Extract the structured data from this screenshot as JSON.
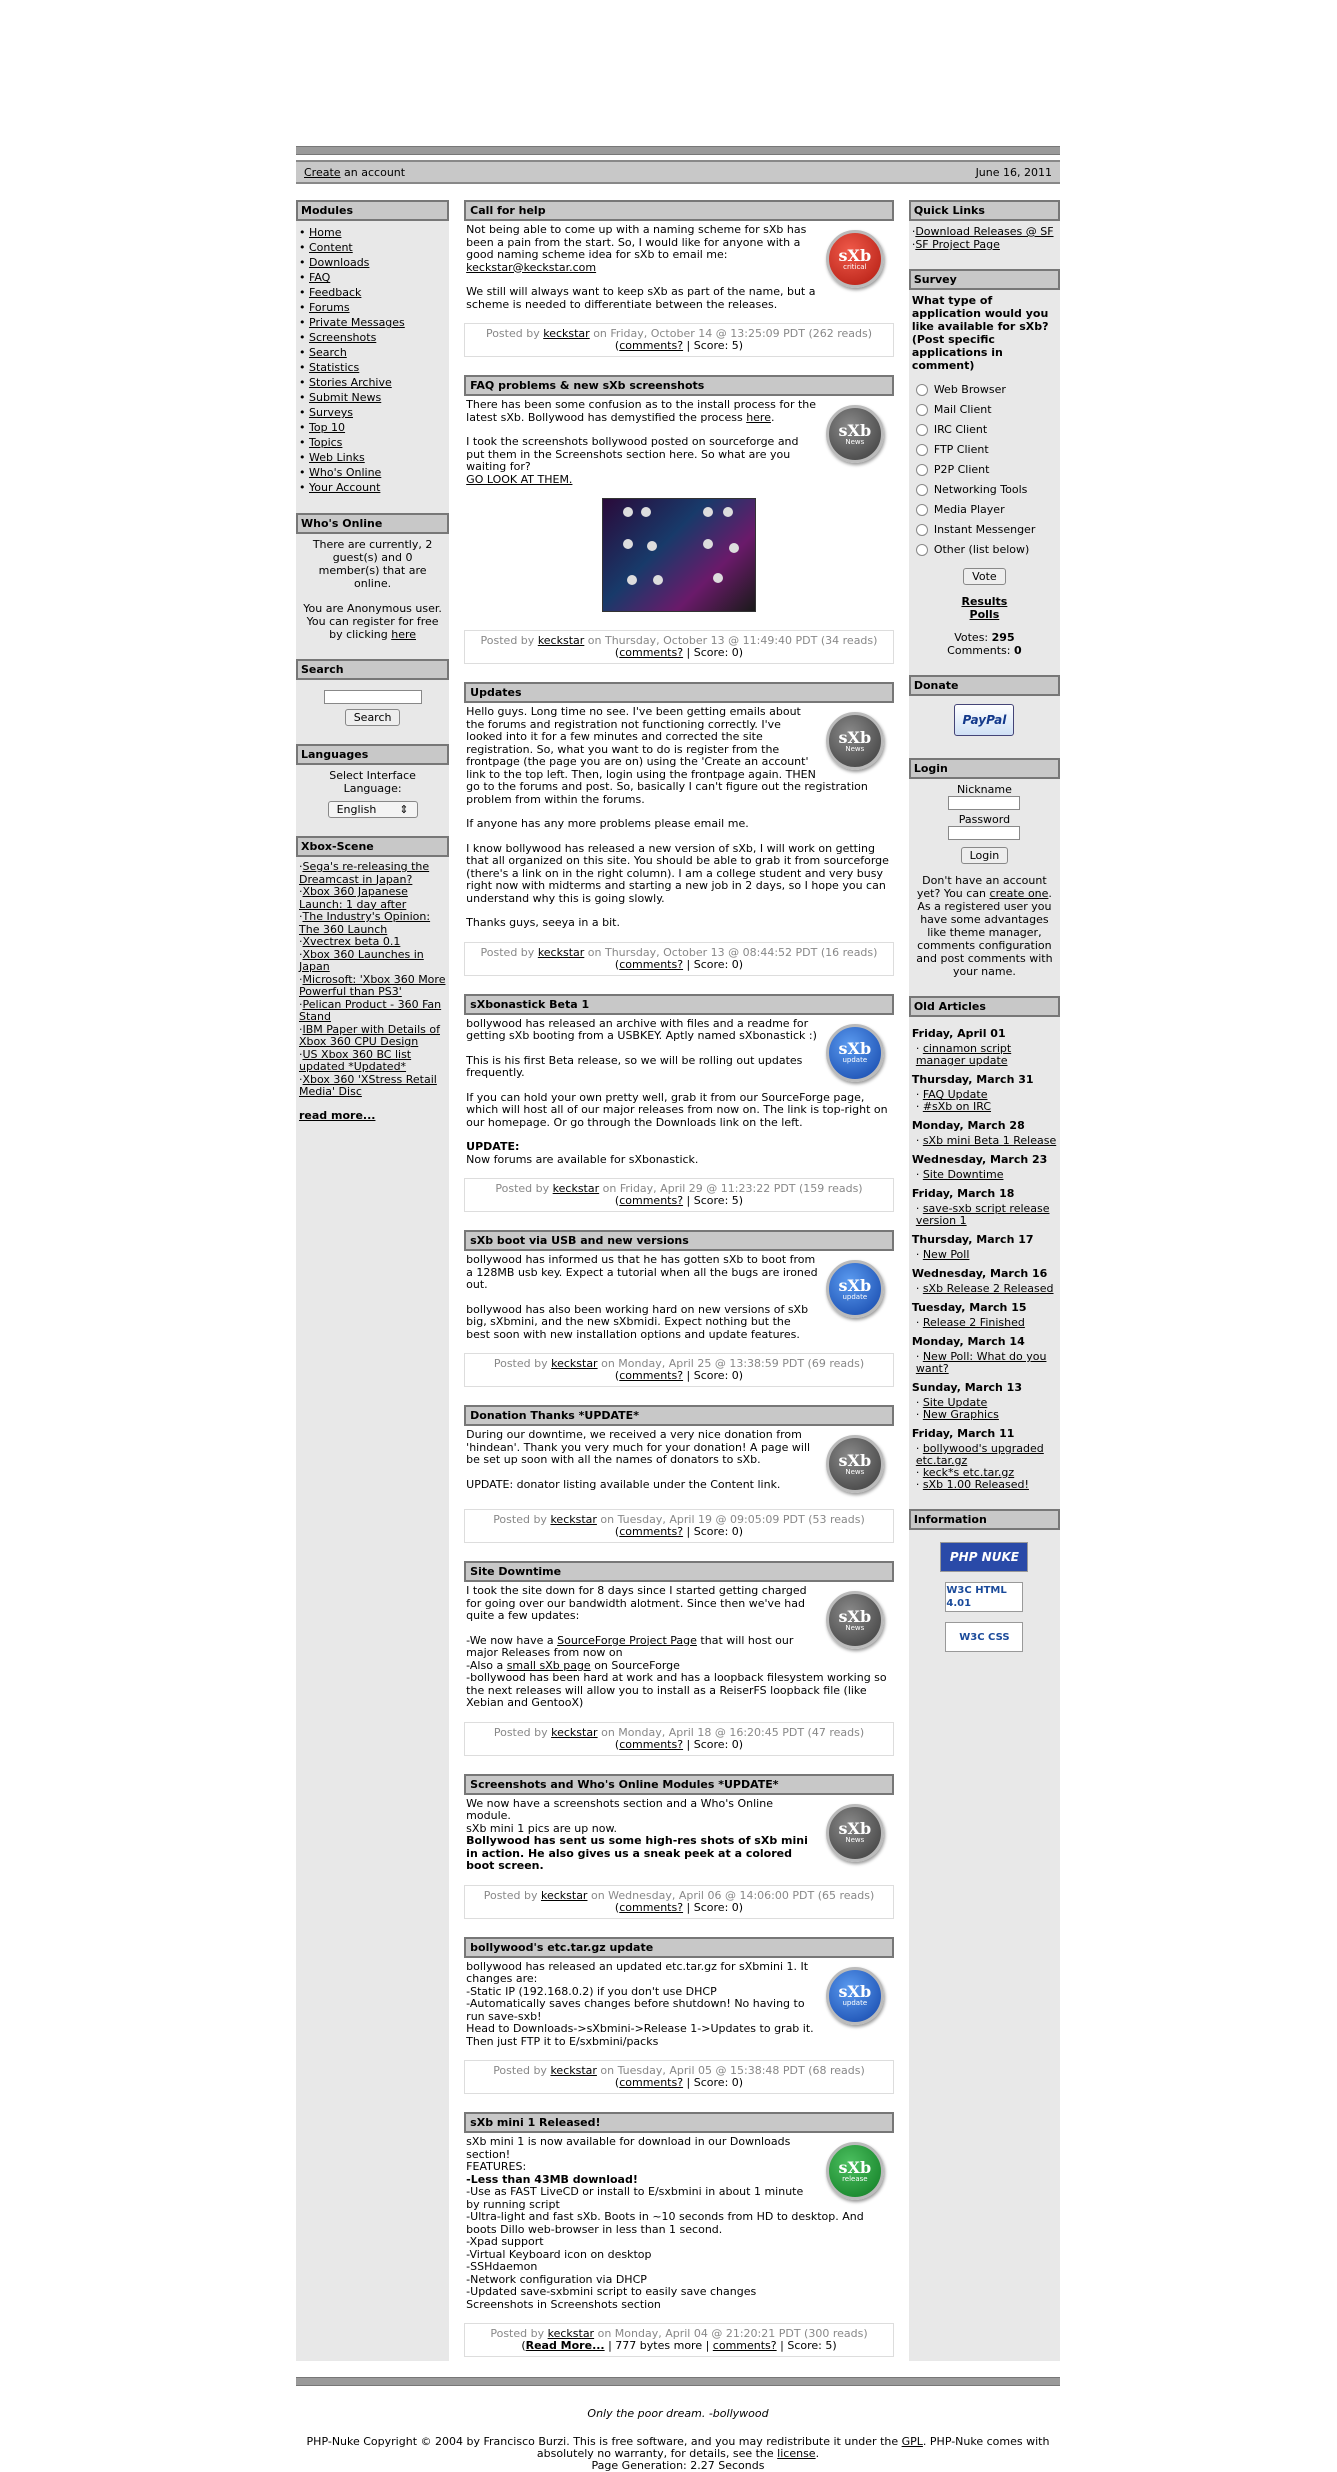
{
  "header": {
    "create_link": "Create",
    "create_rest": " an account",
    "date": "June 16, 2011"
  },
  "left": {
    "modules_title": "Modules",
    "modules": [
      "Home",
      "Content",
      "Downloads",
      "FAQ",
      "Feedback",
      "Forums",
      "Private Messages",
      "Screenshots",
      "Search",
      "Statistics",
      "Stories Archive",
      "Submit News",
      "Surveys",
      "Top 10",
      "Topics",
      "Web Links",
      "Who's Online",
      "Your Account"
    ],
    "whos_online_title": "Who's Online",
    "whos_online_text": "There are currently, 2 guest(s) and 0 member(s) that are online.",
    "anon_text": "You are Anonymous user. You can register for free by clicking",
    "anon_link": "here",
    "search_title": "Search",
    "search_button": "Search",
    "languages_title": "Languages",
    "languages_label": "Select Interface Language:",
    "languages_value": "English",
    "xbox_title": "Xbox-Scene",
    "xbox_items": [
      "Sega's re-releasing the Dreamcast in Japan?",
      "Xbox 360 Japanese Launch: 1 day after",
      "The Industry's Opinion: The 360 Launch",
      "Xvectrex beta 0.1",
      "Xbox 360 Launches in Japan",
      "Microsoft: 'Xbox 360 More Powerful than PS3'",
      "Pelican Product - 360 Fan Stand",
      "IBM Paper with Details of Xbox 360 CPU Design",
      "US Xbox 360 BC list updated *Updated*",
      "Xbox 360 'XStress Retail Media' Disc"
    ],
    "read_more": "read more..."
  },
  "stories": [
    {
      "title": "Call for help",
      "topic": "sXb",
      "topic_sub": "critical",
      "topic_class": "t-critical",
      "paras": [
        "Not being able to come up with a naming scheme for sXb has been a pain from the start. So, I would like for anyone with a good naming scheme idea for sXb to email me:",
        "We still will always want to keep sXb as part of the name, but a scheme is needed to differentiate between the releases."
      ],
      "email": "keckstar@keckstar.com",
      "posted": "Posted by",
      "author": "keckstar",
      "date": " on Friday, October 14 @ 13:25:09 PDT (262 reads)",
      "comments": "comments?",
      "score": " | Score: 5)"
    },
    {
      "title": "FAQ problems & new sXb screenshots",
      "topic": "sXb",
      "topic_sub": "News",
      "topic_class": "t-news",
      "p1": "There has been some confusion as to the install process for the latest sXb. Bollywood has demystified the process ",
      "p1_link": "here",
      "p2": "I took the screenshots bollywood posted on sourceforge and put them in the Screenshots section here. So what are you waiting for?",
      "p2_link": "GO LOOK AT THEM.",
      "posted": "Posted by",
      "author": "keckstar",
      "date": " on Thursday, October 13 @ 11:49:40 PDT (34 reads)",
      "comments": "comments?",
      "score": " | Score: 0)"
    },
    {
      "title": "Updates",
      "topic": "sXb",
      "topic_sub": "News",
      "topic_class": "t-news",
      "paras": [
        "Hello guys. Long time no see. I've been getting emails about the forums and registration not functioning correctly. I've looked into it for a few minutes and corrected the site registration. So, what you want to do is register from the frontpage (the page you are on) using the 'Create an account' link to the top left. Then, login using the frontpage again. THEN go to the forums and post. So, basically I can't figure out the registration problem from within the forums.",
        "If anyone has any more problems please email me.",
        "I know bollywood has released a new version of sXb, I will work on getting that all organized on this site. You should be able to grab it from sourceforge (there's a link on in the right column). I am a college student and very busy right now with midterms and starting a new job in 2 days, so I hope you can understand why this is going slowly.",
        "Thanks guys, seeya in a bit."
      ],
      "posted": "Posted by",
      "author": "keckstar",
      "date": " on Thursday, October 13 @ 08:44:52 PDT (16 reads)",
      "comments": "comments?",
      "score": " | Score: 0)"
    },
    {
      "title": "sXbonastick Beta 1",
      "topic": "sXb",
      "topic_sub": "update",
      "topic_class": "t-update",
      "paras": [
        "bollywood has released an archive with files and a readme for getting sXb booting from a USBKEY. Aptly named sXbonastick :)",
        "This is his first Beta release, so we will be rolling out updates frequently.",
        "If you can hold your own pretty well, grab it from our SourceForge page, which will host all of our major releases from now on. The link is top-right on our homepage. Or go through the Downloads link on the left."
      ],
      "update_label": "UPDATE:",
      "update_text": "Now forums are available for sXbonastick.",
      "posted": "Posted by",
      "author": "keckstar",
      "date": " on Friday, April 29 @ 11:23:22 PDT (159 reads)",
      "comments": "comments?",
      "score": " | Score: 5)"
    },
    {
      "title": "sXb boot via USB and new versions",
      "topic": "sXb",
      "topic_sub": "update",
      "topic_class": "t-update",
      "paras": [
        "bollywood has informed us that he has gotten sXb to boot from a 128MB usb key. Expect a tutorial when all the bugs are ironed out.",
        "bollywood has also been working hard on new versions of sXb big, sXbmini, and the new sXbmidi. Expect nothing but the best soon with new installation options and update features."
      ],
      "posted": "Posted by",
      "author": "keckstar",
      "date": " on Monday, April 25 @ 13:38:59 PDT (69 reads)",
      "comments": "comments?",
      "score": " | Score: 0)"
    },
    {
      "title": "Donation Thanks *UPDATE*",
      "topic": "sXb",
      "topic_sub": "News",
      "topic_class": "t-news",
      "paras": [
        "During our downtime, we received a very nice donation from 'hindean'. Thank you very much for your donation! A page will be set up soon with all the names of donators to sXb.",
        "UPDATE: donator listing available under the Content link."
      ],
      "posted": "Posted by",
      "author": "keckstar",
      "date": " on Tuesday, April 19 @ 09:05:09 PDT (53 reads)",
      "comments": "comments?",
      "score": " | Score: 0)"
    },
    {
      "title": "Site Downtime",
      "topic": "sXb",
      "topic_sub": "News",
      "topic_class": "t-news",
      "p1": "I took the site down for 8 days since I started getting charged for going over our bandwidth alotment. Since then we've had quite a few updates:",
      "l1a": "-We now have a ",
      "l1_link": "SourceForge Project Page",
      "l1b": " that will host our major Releases from now on",
      "l2a": "-Also a ",
      "l2_link": "small sXb page",
      "l2b": " on SourceForge",
      "l3": "-bollywood has been hard at work and has a loopback filesystem working so the next releases will allow you to install as a ReiserFS loopback file (like Xebian and GentooX)",
      "posted": "Posted by",
      "author": "keckstar",
      "date": " on Monday, April 18 @ 16:20:45 PDT (47 reads)",
      "comments": "comments?",
      "score": " | Score: 0)"
    },
    {
      "title": "Screenshots and Who's Online Modules *UPDATE*",
      "topic": "sXb",
      "topic_sub": "News",
      "topic_class": "t-news",
      "p1": "We now have a screenshots section and a Who's Online module.",
      "p2": "sXb mini 1 pics are up now.",
      "p3": "Bollywood has sent us some high-res shots of sXb mini in action. He also gives us a sneak peek at a colored boot screen.",
      "posted": "Posted by",
      "author": "keckstar",
      "date": " on Wednesday, April 06 @ 14:06:00 PDT (65 reads)",
      "comments": "comments?",
      "score": " | Score: 0)"
    },
    {
      "title": "bollywood's etc.tar.gz update",
      "topic": "sXb",
      "topic_sub": "update",
      "topic_class": "t-update",
      "lines": [
        "bollywood has released an updated etc.tar.gz for sXbmini 1. It changes are:",
        "-Static IP (192.168.0.2) if you don't use DHCP",
        "-Automatically saves changes before shutdown! No having to run save-sxb!",
        "Head to Downloads->sXbmini->Release 1->Updates to grab it. Then just FTP it to E/sxbmini/packs"
      ],
      "posted": "Posted by",
      "author": "keckstar",
      "date": " on Tuesday, April 05 @ 15:38:48 PDT (68 reads)",
      "comments": "comments?",
      "score": " | Score: 0)"
    },
    {
      "title": "sXb mini 1 Released!",
      "topic": "sXb",
      "topic_sub": "release",
      "topic_class": "t-release",
      "l1": "sXb mini 1 is now available for download in our Downloads section!",
      "l2": "FEATURES:",
      "l3": "-Less than 43MB download!",
      "lines": [
        "-Use as FAST LiveCD or install to E/sxbmini in about 1 minute by running script",
        "-Ultra-light and fast sXb. Boots in ~10 seconds from HD to desktop. And boots Dillo web-browser in less than 1 second.",
        "-Xpad support",
        "-Virtual Keyboard icon on desktop",
        "-SSHdaemon",
        "-Network configuration via DHCP",
        "-Updated save-sxbmini script to easily save changes",
        "Screenshots in Screenshots section"
      ],
      "posted": "Posted by",
      "author": "keckstar",
      "date": " on Monday, April 04 @ 21:20:21 PDT (300 reads)",
      "read_more": "Read More...",
      "bytes": " | 777 bytes more | ",
      "comments": "comments?",
      "score": " | Score: 5)"
    }
  ],
  "right": {
    "quick_title": "Quick Links",
    "quick_links": [
      "Download Releases @ SF",
      "SF Project Page"
    ],
    "survey_title": "Survey",
    "survey_question": "What type of application would you like available for sXb? (Post specific applications in comment)",
    "survey_options": [
      "Web Browser",
      "Mail Client",
      "IRC Client",
      "FTP Client",
      "P2P Client",
      "Networking Tools",
      "Media Player",
      "Instant Messenger",
      "Other (list below)"
    ],
    "vote_button": "Vote",
    "results": "Results",
    "polls": "Polls",
    "votes_label": "Votes:",
    "votes_value": "295",
    "comments_label": "Comments:",
    "comments_value": "0",
    "donate_title": "Donate",
    "paypal": "PayPal",
    "login_title": "Login",
    "nickname_label": "Nickname",
    "password_label": "Password",
    "login_button": "Login",
    "login_text_a": "Don't have an account yet? You can ",
    "login_link": "create one",
    "login_text_b": ". As a registered user you have some advantages like theme manager, comments configuration and post comments with your name.",
    "old_title": "Old Articles",
    "old": [
      {
        "day": "Friday, April 01",
        "items": [
          "cinnamon script manager update"
        ]
      },
      {
        "day": "Thursday, March 31",
        "items": [
          "FAQ Update",
          "#sXb on IRC"
        ]
      },
      {
        "day": "Monday, March 28",
        "items": [
          "sXb mini Beta 1 Release"
        ]
      },
      {
        "day": "Wednesday, March 23",
        "items": [
          "Site Downtime"
        ]
      },
      {
        "day": "Friday, March 18",
        "items": [
          "save-sxb script release version 1"
        ]
      },
      {
        "day": "Thursday, March 17",
        "items": [
          "New Poll"
        ]
      },
      {
        "day": "Wednesday, March 16",
        "items": [
          "sXb Release 2 Released"
        ]
      },
      {
        "day": "Tuesday, March 15",
        "items": [
          "Release 2 Finished"
        ]
      },
      {
        "day": "Monday, March 14",
        "items": [
          "New Poll: What do you want?"
        ]
      },
      {
        "day": "Sunday, March 13",
        "items": [
          "Site Update",
          "New Graphics"
        ]
      },
      {
        "day": "Friday, March 11",
        "items": [
          "bollywood's upgraded etc.tar.gz",
          "keck*s etc.tar.gz",
          "sXb 1.00 Released!"
        ]
      }
    ],
    "info_title": "Information",
    "badge_phpnuke": "PHP NUKE",
    "badge_html": "W3C HTML 4.01",
    "badge_css": "W3C CSS"
  },
  "footer": {
    "slogan": "Only the poor dream. -bollywood",
    "copy_a": "PHP-Nuke Copyright © 2004 by Francisco Burzi. This is free software, and you may redistribute it under the ",
    "gpl": "GPL",
    "copy_b": ". PHP-Nuke comes with absolutely no warranty, for details, see the ",
    "license": "license",
    "copy_c": ".",
    "generation": "Page Generation: 2.27 Seconds"
  }
}
